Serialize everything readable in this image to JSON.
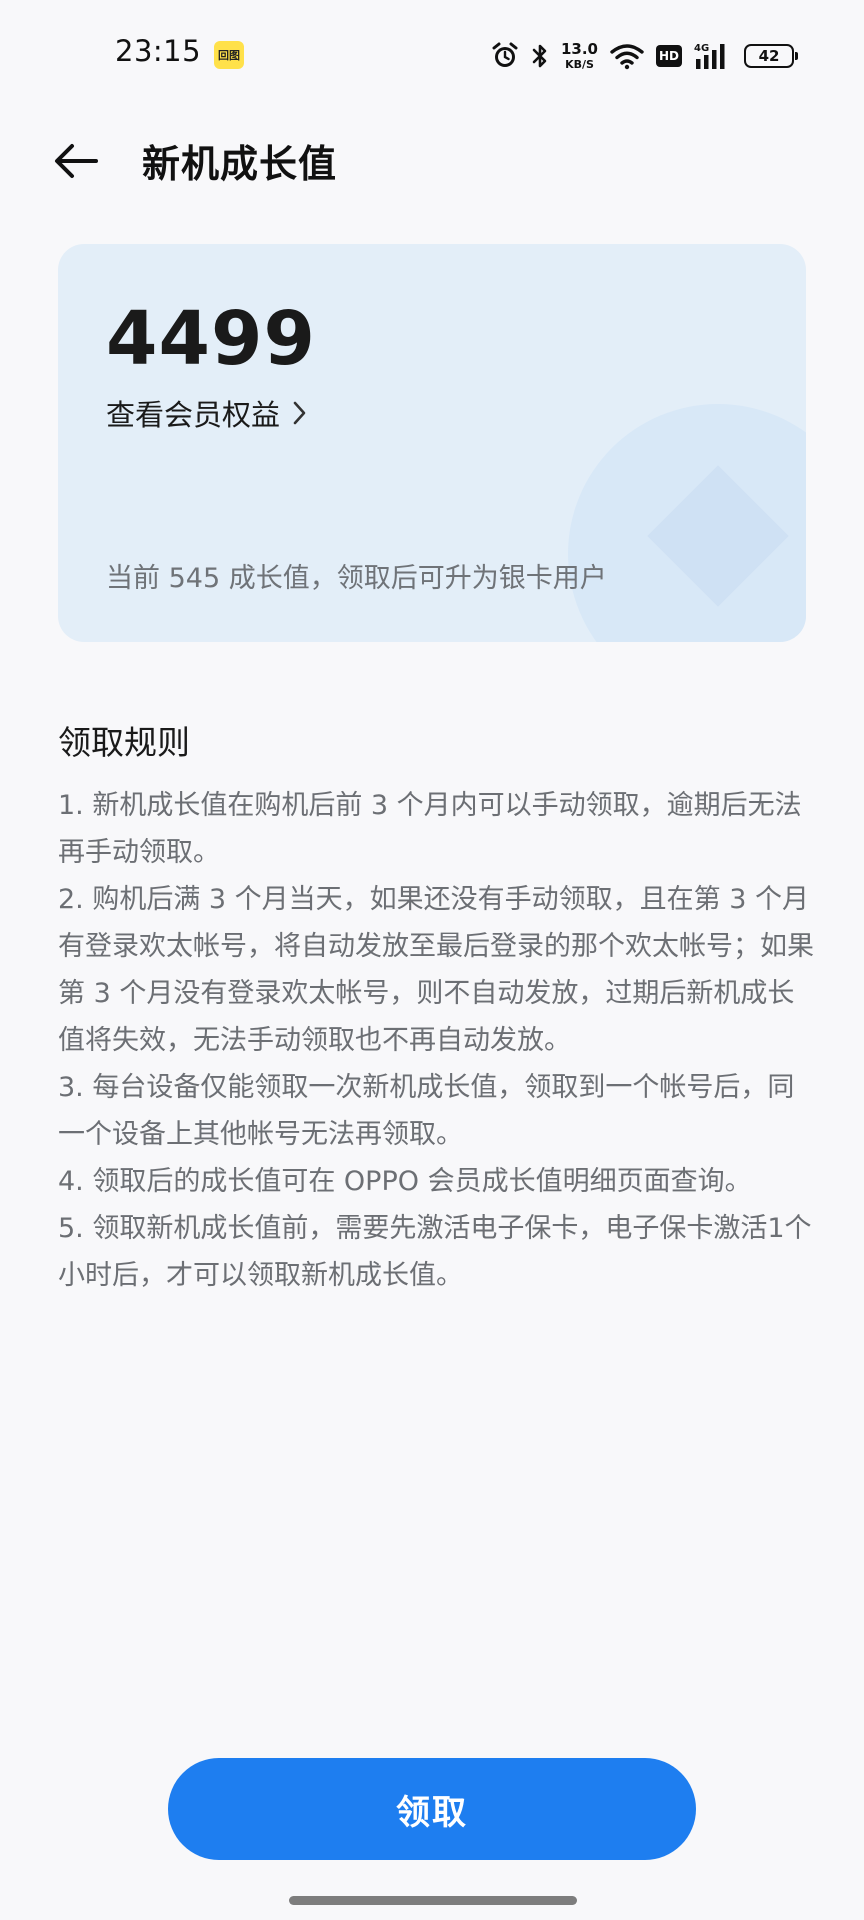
{
  "status_bar": {
    "time": "23:15",
    "app_badge": "回图",
    "net_speed_value": "13.0",
    "net_speed_unit": "KB/S",
    "hd_label": "HD",
    "network_label": "4G",
    "battery_level": "42"
  },
  "header": {
    "title": "新机成长值"
  },
  "card": {
    "value": "4499",
    "benefits_link": "查看会员权益",
    "status_text": "当前 545 成长值，领取后可升为银卡用户"
  },
  "rules": {
    "title": "领取规则",
    "items": [
      "1. 新机成长值在购机后前 3 个月内可以手动领取，逾期后无法再手动领取。",
      "2. 购机后满 3 个月当天，如果还没有手动领取，且在第 3 个月有登录欢太帐号，将自动发放至最后登录的那个欢太帐号；如果第 3 个月没有登录欢太帐号，则不自动发放，过期后新机成长值将失效，无法手动领取也不再自动发放。",
      "3. 每台设备仅能领取一次新机成长值，领取到一个帐号后，同一个设备上其他帐号无法再领取。",
      "4. 领取后的成长值可在 OPPO 会员成长值明细页面查询。",
      "5. 领取新机成长值前，需要先激活电子保卡，电子保卡激活1个小时后，才可以领取新机成长值。"
    ]
  },
  "claim_button": {
    "label": "领取"
  },
  "colors": {
    "accent": "#1e7ef0",
    "card_bg": "#e3eef8",
    "page_bg": "#f8f8fa"
  }
}
